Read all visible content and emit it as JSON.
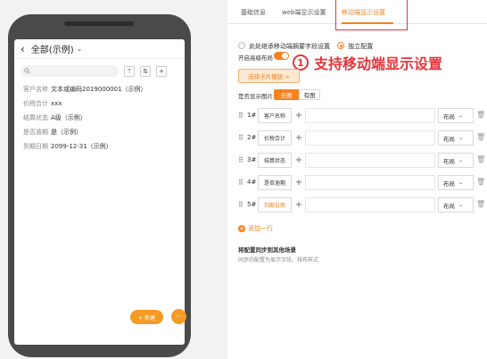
{
  "phone": {
    "back_icon": "chevron-left-icon",
    "title": "全部(示例)",
    "title_dropdown_icon": "chevron-down-icon",
    "search_placeholder": "",
    "toolbar_icons": [
      "filter-icon",
      "sort-icon",
      "add-icon"
    ],
    "filter_glyph": "⊤",
    "sort_glyph": "⇅",
    "add_glyph": "+",
    "fields": [
      {
        "label": "客户名称",
        "value": "文本或编码2019000001（示例）"
      },
      {
        "label": "价税合计",
        "value": "xxx"
      },
      {
        "label": "结算状态",
        "value": "A级（示例）"
      },
      {
        "label": "是否逾期",
        "value": "是（示例）"
      },
      {
        "label": "到期日期",
        "value": "2099-12-31（示例）"
      }
    ],
    "new_button": "+ 新建",
    "more_button": "···"
  },
  "panel": {
    "tabs": [
      "基础信息",
      "web端显示设置",
      "移动端显示设置"
    ],
    "active_tab": 2,
    "source_options": [
      "此处继承移动端摘要字段设置",
      "独立配置"
    ],
    "source_selected": 1,
    "advanced_layout_label": "开启高级布局",
    "advanced_layout_on": true,
    "annotation": {
      "number": "1",
      "text": "支持移动端显示设置"
    },
    "card_template_button": "选择卡片模版  >",
    "show_image_label": "是否显示图片",
    "image_options": [
      "无图",
      "有图"
    ],
    "image_selected": 0,
    "rows": [
      {
        "index": "1#",
        "field": "客户名称",
        "layout": "布局",
        "highlight": false
      },
      {
        "index": "2#",
        "field": "价税合计",
        "layout": "布局",
        "highlight": false
      },
      {
        "index": "3#",
        "field": "结算状态",
        "layout": "布局",
        "highlight": false
      },
      {
        "index": "4#",
        "field": "是否逾期",
        "layout": "布局",
        "highlight": false
      },
      {
        "index": "5#",
        "field": "到期日期",
        "layout": "布局",
        "highlight": true
      }
    ],
    "add_row_label": "添加一行",
    "sync_title": "将配置同步到其他场景",
    "sync_desc": "同步的配置为显示字段、排布样式",
    "accent_color": "#f5821f",
    "annotation_color": "#e5343a"
  }
}
